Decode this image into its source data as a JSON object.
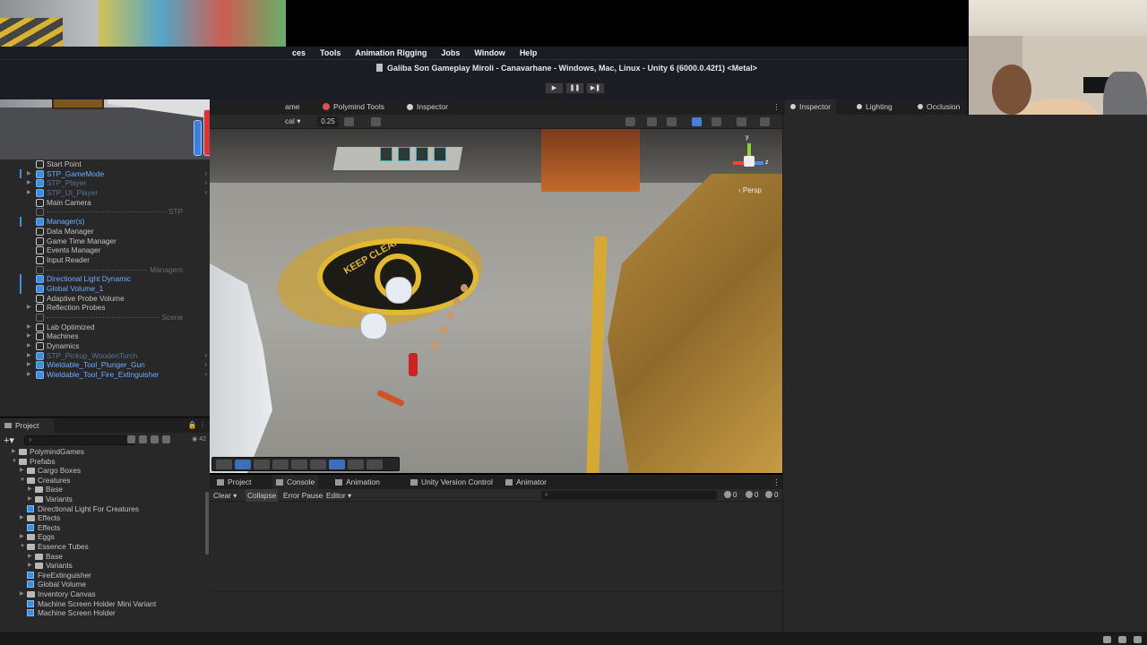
{
  "menu": [
    "ces",
    "Tools",
    "Animation Rigging",
    "Jobs",
    "Window",
    "Help"
  ],
  "window_title": "Galiba Son Gameplay Miroli - Canavarhane - Windows, Mac, Linux - Unity 6 (6000.0.42f1) <Metal>",
  "play_controls": {
    "play": "▶",
    "pause": "❚❚",
    "step": "▶❚"
  },
  "scene_tabs": {
    "game": "ame",
    "polymind": "Polymind Tools",
    "inspector": "Inspector"
  },
  "scene_toolbar": {
    "scale_label": "cal",
    "zoom": "0.25"
  },
  "scene_overlay": {
    "persp": "Persp",
    "gizmo_y": "y",
    "gizmo_z": "z",
    "floor_text": "KEEP CLEAR"
  },
  "hierarchy": [
    {
      "label": "Start Point",
      "type": "go",
      "indent": 0,
      "arrow": false
    },
    {
      "label": "STP_GameMode",
      "type": "blue",
      "arrow": true,
      "selected": true
    },
    {
      "label": "STP_Player",
      "type": "dim",
      "arrow": true
    },
    {
      "label": "STP_UI_Player",
      "type": "dim",
      "arrow": true
    },
    {
      "label": "Main Camera",
      "type": "go",
      "arrow": false
    },
    {
      "label": "STP",
      "type": "sep"
    },
    {
      "label": "Manager(s)",
      "type": "blue",
      "arrow": false,
      "selected": true
    },
    {
      "label": "Data Manager",
      "type": "go"
    },
    {
      "label": "Game Time Manager",
      "type": "go"
    },
    {
      "label": "Events Manager",
      "type": "go"
    },
    {
      "label": "Input Reader",
      "type": "go"
    },
    {
      "label": "Managers",
      "type": "sep"
    },
    {
      "label": "Directional Light Dynamic",
      "type": "blue",
      "selected": true
    },
    {
      "label": "Global Volume_1",
      "type": "blue",
      "selected": true
    },
    {
      "label": "Adaptive Probe Volume",
      "type": "go"
    },
    {
      "label": "Reflection Probes",
      "type": "go",
      "arrow": true
    },
    {
      "label": "Scene",
      "type": "sep"
    },
    {
      "label": "Lab Optimized",
      "type": "go",
      "arrow": true
    },
    {
      "label": "Machines",
      "type": "go",
      "arrow": true
    },
    {
      "label": "Dynamics",
      "type": "go",
      "arrow": true
    },
    {
      "label": "STP_Pickup_WoodenTorch",
      "type": "dim",
      "arrow": true
    },
    {
      "label": "Wieldable_Tool_Plunger_Gun",
      "type": "blue",
      "arrow": true
    },
    {
      "label": "Wieldable_Tool_Fire_Extinguisher",
      "type": "blue",
      "arrow": true
    }
  ],
  "project": {
    "tab": "Project",
    "count": "42",
    "search_placeholder": "",
    "items": [
      {
        "label": "PolymindGames",
        "type": "folder",
        "depth": 1,
        "arrow": "▶"
      },
      {
        "label": "Prefabs",
        "type": "folder",
        "depth": 1,
        "arrow": "▼"
      },
      {
        "label": "Cargo Boxes",
        "type": "folder",
        "depth": 2,
        "arrow": "▶"
      },
      {
        "label": "Creatures",
        "type": "folder",
        "depth": 2,
        "arrow": "▼"
      },
      {
        "label": "Base",
        "type": "folder",
        "depth": 3,
        "arrow": "▶"
      },
      {
        "label": "Variants",
        "type": "folder",
        "depth": 3,
        "arrow": "▶"
      },
      {
        "label": "Directional Light For Creatures",
        "type": "prefab",
        "depth": 2
      },
      {
        "label": "Effects",
        "type": "folder",
        "depth": 2,
        "arrow": "▶"
      },
      {
        "label": "Effects",
        "type": "prefab",
        "depth": 2
      },
      {
        "label": "Eggs",
        "type": "folder",
        "depth": 2,
        "arrow": "▶"
      },
      {
        "label": "Essence Tubes",
        "type": "folder",
        "depth": 2,
        "arrow": "▼"
      },
      {
        "label": "Base",
        "type": "folder",
        "depth": 3,
        "arrow": "▶"
      },
      {
        "label": "Variants",
        "type": "folder",
        "depth": 3,
        "arrow": "▶"
      },
      {
        "label": "FireExtinguisher",
        "type": "prefab",
        "depth": 2
      },
      {
        "label": "Global Volume",
        "type": "prefab",
        "depth": 2
      },
      {
        "label": "Inventory Canvas",
        "type": "folder",
        "depth": 2,
        "arrow": "▶"
      },
      {
        "label": "Machine Screen Holder Mini Variant",
        "type": "prefab",
        "depth": 2
      },
      {
        "label": "Machine Screen Holder",
        "type": "prefab",
        "depth": 2
      }
    ]
  },
  "console": {
    "tabs": [
      "Project",
      "Console",
      "Animation",
      "Unity Version Control",
      "Animator"
    ],
    "active_tab": "Console",
    "clear": "Clear",
    "collapse": "Collapse",
    "error_pause": "Error Pause",
    "editor": "Editor",
    "counts": {
      "info": "0",
      "warn": "0",
      "error": "0"
    }
  },
  "inspector_tabs": [
    "Inspector",
    "Lighting",
    "Occlusion"
  ],
  "colors": {
    "accent": "#3d8ee0",
    "panel": "#282828",
    "tabbar": "#1f1f1f",
    "menubar": "#1a1d24"
  }
}
